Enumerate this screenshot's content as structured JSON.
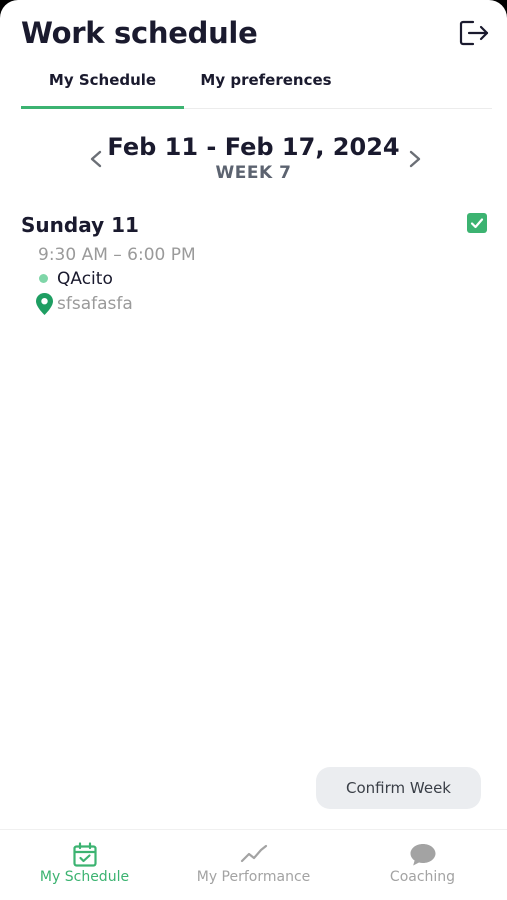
{
  "header": {
    "title": "Work schedule",
    "logout_icon": "logout-icon"
  },
  "tabs": [
    {
      "label": "My Schedule",
      "active": true
    },
    {
      "label": "My preferences",
      "active": false
    }
  ],
  "week": {
    "range": "Feb 11 - Feb 17, 2024",
    "label": "WEEK 7",
    "prev_icon": "chevron-left-icon",
    "next_icon": "chevron-right-icon"
  },
  "days": [
    {
      "title": "Sunday 11",
      "checked": true,
      "time": "9:30 AM – 6:00 PM",
      "position": "QAcito",
      "location": "sfsafasfa"
    }
  ],
  "actions": {
    "confirm_label": "Confirm Week"
  },
  "bottom_nav": [
    {
      "label": "My Schedule",
      "icon": "calendar-check-icon",
      "active": true
    },
    {
      "label": "My Performance",
      "icon": "trend-line-icon",
      "active": false
    },
    {
      "label": "Coaching",
      "icon": "chat-bubble-icon",
      "active": false
    }
  ],
  "colors": {
    "accent": "#3cb371",
    "position_dot": "#7fd6a8",
    "location_pin": "#1e9e62",
    "text_primary": "#1a1a2e",
    "text_muted": "#9a9a9a",
    "inactive_nav": "#a3a3a3"
  }
}
